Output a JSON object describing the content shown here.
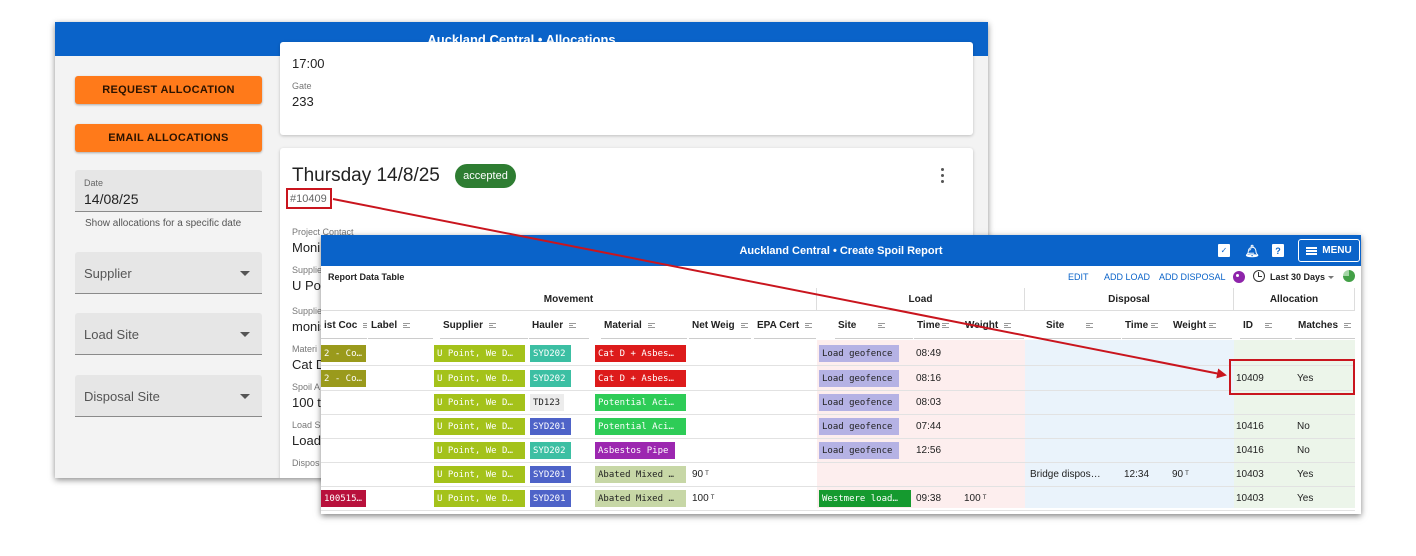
{
  "win1": {
    "title": "Auckland Central • Allocations",
    "request_btn": "REQUEST ALLOCATION",
    "email_btn": "EMAIL ALLOCATIONS",
    "date_label": "Date",
    "date_value": "14/08/25",
    "date_hint": "Show allocations for a specific date",
    "supplier_select": "Supplier",
    "load_site_select": "Load Site",
    "disposal_site_select": "Disposal Site",
    "prev_card": {
      "time": "17:00",
      "gate_label": "Gate",
      "gate_value": "233"
    },
    "card": {
      "title": "Thursday 14/8/25",
      "status": "accepted",
      "id": "#10409",
      "project_contact_label": "Project Contact",
      "project_contact_value": "Moni",
      "supplier_label": "Supplie",
      "supplier_value": "U Po",
      "supplier2_label": "Supplie",
      "supplier2_value": "monist",
      "material_label": "Materi",
      "material_value": "Cat D",
      "spoil_label": "Spoil A",
      "spoil_value": "100 t",
      "load_label": "Load S",
      "load_value": "Load",
      "disposal_label": "Dispos"
    }
  },
  "win2": {
    "title": "Auckland Central • Create Spoil Report",
    "menu": "MENU",
    "toolbar": {
      "label": "Report Data Table",
      "edit": "EDIT",
      "add_load": "ADD LOAD",
      "add_disposal": "ADD DISPOSAL",
      "range": "Last 30 Days"
    },
    "groups": {
      "movement": "Movement",
      "load": "Load",
      "disposal": "Disposal",
      "allocation": "Allocation"
    },
    "columns": {
      "cost_code": "ist Coc",
      "label": "Label",
      "supplier": "Supplier",
      "hauler": "Hauler",
      "material": "Material",
      "net_weight": "Net Weig",
      "epa": "EPA Cert",
      "load_site": "Site",
      "load_time": "Time",
      "load_weight": "Weight",
      "disp_site": "Site",
      "disp_time": "Time",
      "disp_weight": "Weight",
      "alloc_id": "ID",
      "matches": "Matches"
    },
    "rows": [
      {
        "cost": "2 - Co…",
        "supplier": "U Point, We D…",
        "hauler": "SYD202",
        "material": "Cat D + Asbes…",
        "net": "",
        "load_site": "Load geofence",
        "load_time": "08:49",
        "load_weight": "",
        "disp_site": "",
        "disp_time": "",
        "disp_weight": "",
        "id": "",
        "matches": ""
      },
      {
        "cost": "2 - Co…",
        "supplier": "U Point, We D…",
        "hauler": "SYD202",
        "material": "Cat D + Asbes…",
        "net": "",
        "load_site": "Load geofence",
        "load_time": "08:16",
        "load_weight": "",
        "disp_site": "",
        "disp_time": "",
        "disp_weight": "",
        "id": "10409",
        "matches": "Yes"
      },
      {
        "cost": "",
        "supplier": "U Point, We D…",
        "hauler": "TD123",
        "material": "Potential Aci…",
        "net": "",
        "load_site": "Load geofence",
        "load_time": "08:03",
        "load_weight": "",
        "disp_site": "",
        "disp_time": "",
        "disp_weight": "",
        "id": "",
        "matches": ""
      },
      {
        "cost": "",
        "supplier": "U Point, We D…",
        "hauler": "SYD201",
        "material": "Potential Aci…",
        "net": "",
        "load_site": "Load geofence",
        "load_time": "07:44",
        "load_weight": "",
        "disp_site": "",
        "disp_time": "",
        "disp_weight": "",
        "id": "10416",
        "matches": "No"
      },
      {
        "cost": "",
        "supplier": "U Point, We D…",
        "hauler": "SYD202",
        "material": "Asbestos Pipe",
        "net": "",
        "load_site": "Load geofence",
        "load_time": "12:56",
        "load_weight": "",
        "disp_site": "",
        "disp_time": "",
        "disp_weight": "",
        "id": "10416",
        "matches": "No"
      },
      {
        "cost": "",
        "supplier": "U Point, We D…",
        "hauler": "SYD201",
        "material": "Abated Mixed …",
        "net": "90",
        "load_site": "",
        "load_time": "",
        "load_weight": "",
        "disp_site": "Bridge dispos…",
        "disp_time": "12:34",
        "disp_weight": "90",
        "id": "10403",
        "matches": "Yes"
      },
      {
        "cost": "100515…",
        "supplier": "U Point, We D…",
        "hauler": "SYD201",
        "material": "Abated Mixed …",
        "net": "100",
        "load_site": "Westmere load…",
        "load_time": "09:38",
        "load_weight": "100",
        "disp_site": "",
        "disp_time": "",
        "disp_weight": "",
        "id": "10403",
        "matches": "Yes"
      }
    ],
    "unit": "T"
  },
  "colors": {
    "appbar": "#0a63c9",
    "orange": "#ff7a1a",
    "accepted": "#2e7d32",
    "highlight": "#c9151e",
    "olive": "#9a9a1c",
    "lime": "#a4c21a",
    "teal": "#3cbfa3",
    "indigo": "#4e63c8",
    "red": "#dd1b1b",
    "green": "#2ecc57",
    "purple": "#9c27b0",
    "sage": "#c7d7a6",
    "lavender": "#b5b2e4",
    "darkgreen": "#159a2f",
    "crimson": "#b8113c"
  }
}
